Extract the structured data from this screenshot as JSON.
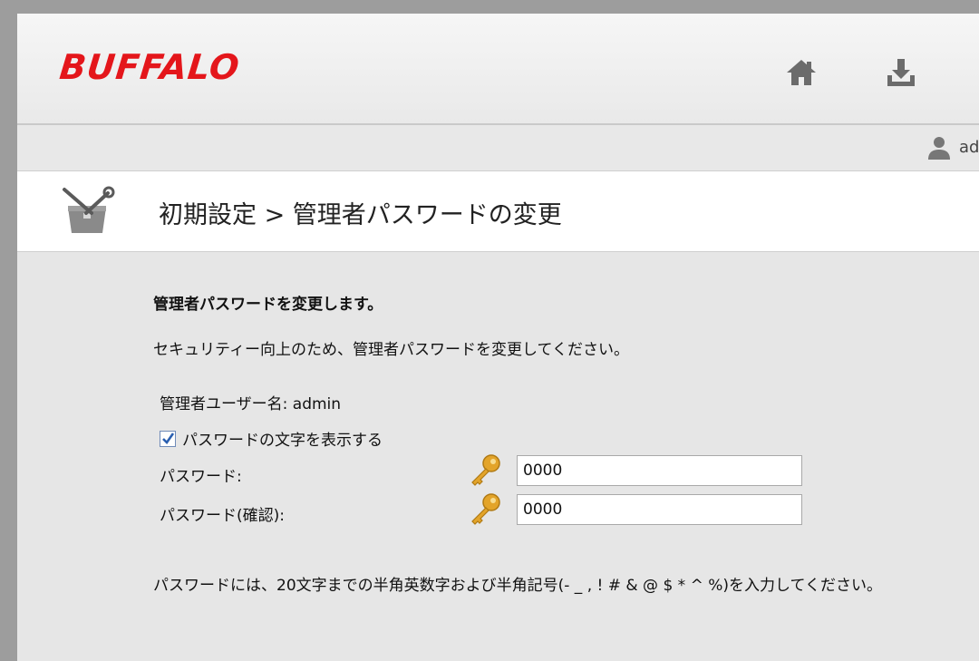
{
  "header": {
    "logo": "BUFFALO",
    "icons": [
      "home-icon",
      "download-icon"
    ]
  },
  "user_bar": {
    "user_name": "ad"
  },
  "page": {
    "title": "初期設定 > 管理者パスワードの変更",
    "heading": "管理者パスワードを変更します。",
    "intro": "セキュリティー向上のため、管理者パスワードを変更してください。",
    "username_line": "管理者ユーザー名: admin",
    "show_password_label": "パスワードの文字を表示する",
    "show_password_checked": true,
    "password_label": "パスワード:",
    "password_value": "0000",
    "confirm_label": "パスワード(確認):",
    "confirm_value": "0000",
    "note": "パスワードには、20文字までの半角英数字および半角記号(- _ , ! # & @ $ * ^ %)を入力してください。"
  },
  "colors": {
    "brand": "#e4161b",
    "background": "#e6e6e6",
    "checkbox_check": "#2a5fb0",
    "key": "#e3a42a"
  }
}
